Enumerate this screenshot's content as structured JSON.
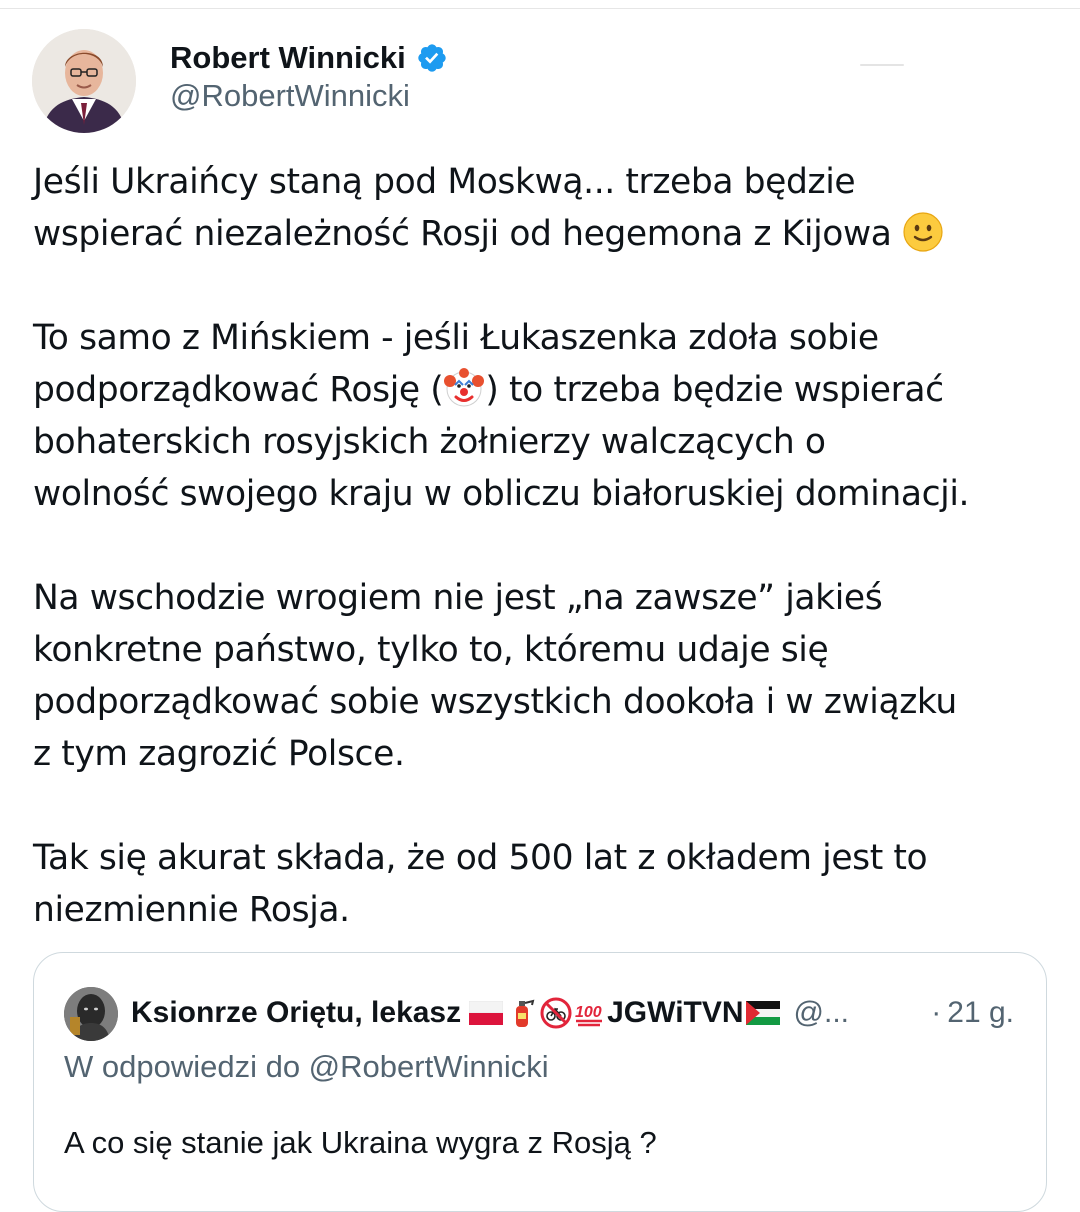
{
  "tweet": {
    "author": {
      "display_name": "Robert Winnicki",
      "handle": "@RobertWinnicki",
      "verified": true
    },
    "paragraphs": [
      {
        "lines": [
          "Jeśli Ukraińcy staną pod Moskwą... trzeba będzie",
          "wspierać niezależność Rosji od hegemona z Kijowa"
        ],
        "trailing_emoji": "slightly-smiling-face"
      },
      {
        "lines": [
          "To samo z Mińskiem - jeśli Łukaszenka zdoła sobie",
          "podporządkować Rosję (",
          ") to trzeba będzie wspierać",
          "bohaterskich rosyjskich żołnierzy walczących o",
          "wolność swojego kraju w obliczu białoruskiej dominacji."
        ],
        "inline_emoji": "clown-face"
      },
      {
        "lines": [
          "Na wschodzie wrogiem nie jest „na zawsze” jakieś",
          "konkretne państwo, tylko to, któremu udaje się",
          "podporządkować sobie wszystkich dookoła i w związku",
          "z tym zagrozić Polsce."
        ]
      },
      {
        "lines": [
          "Tak się akurat składa, że od 500 lat z okładem jest to",
          "niezmiennie Rosja."
        ]
      }
    ]
  },
  "quoted_tweet": {
    "author_name": "Ksionrze Oriętu, lekasz",
    "name_suffix": "JGWiTVN",
    "name_emojis": [
      "flag-poland",
      "fire-extinguisher",
      "no-bicycles-sign",
      "hundred-points"
    ],
    "trailing_flag": "flag-palestine",
    "handle": "@...",
    "time": "21 g.",
    "time_separator": "·",
    "reply_to": "W odpowiedzi do @RobertWinnicki",
    "text": "A co się stanie jak Ukraina wygra z Rosją ?"
  },
  "colors": {
    "text_primary": "#0f1419",
    "text_secondary": "#536471",
    "verified_blue": "#1d9bf0",
    "card_border": "#cfd9de"
  }
}
